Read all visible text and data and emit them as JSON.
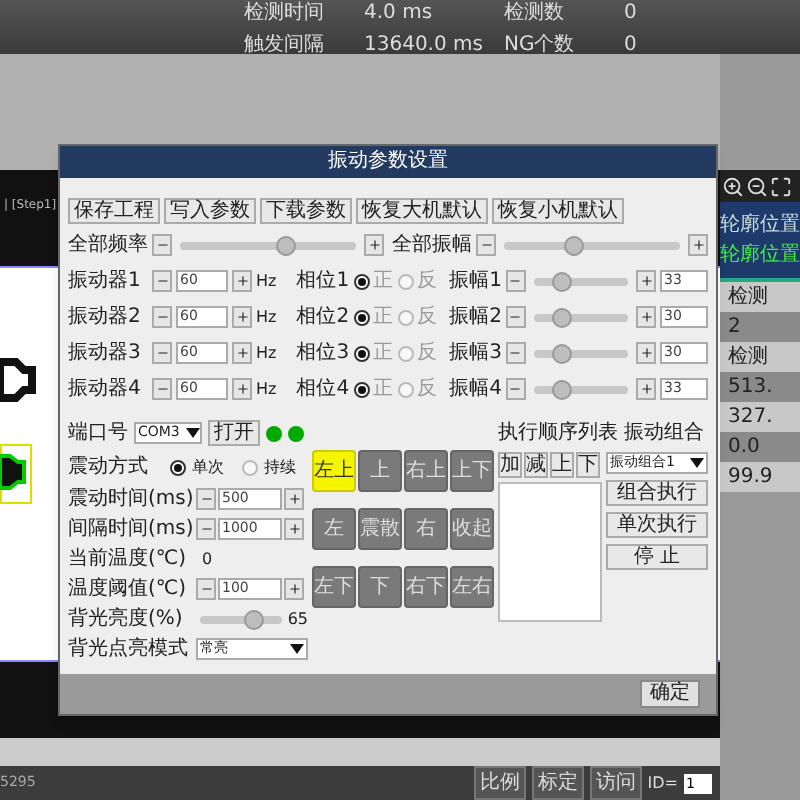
{
  "top_stats": [
    {
      "label": "检测时间",
      "value": "4.0 ms"
    },
    {
      "label": "检测数",
      "value": "0"
    },
    {
      "label": "触发间隔",
      "value": "13640.0 ms"
    },
    {
      "label": "NG个数",
      "value": "0"
    }
  ],
  "view": {
    "step_label": "| [Step1]",
    "status": "5295"
  },
  "side_panel": {
    "heading": "轮廓位置",
    "subheading": "轮廓位置",
    "rows": [
      "检测",
      "2",
      "检测",
      "513.",
      "327.",
      "0.0",
      "99.9"
    ]
  },
  "bottom_bar": {
    "buttons": [
      "比例",
      "标定",
      "访问"
    ],
    "id_label": "ID=",
    "id_value": "1"
  },
  "dialog": {
    "title": "振动参数设置",
    "toolbar": [
      "保存工程",
      "写入参数",
      "下载参数",
      "恢复大机默认",
      "恢复小机默认"
    ],
    "all_freq": {
      "label": "全部频率",
      "level": 0.6
    },
    "all_amp": {
      "label": "全部振幅",
      "level": 0.4
    },
    "vibrators": [
      {
        "name": "振动器1",
        "freq": "60",
        "unit": "Hz",
        "phase_label": "相位1",
        "phases": [
          {
            "label": "正",
            "selected": true
          },
          {
            "label": "反",
            "selected": false
          }
        ],
        "amp_label": "振幅1",
        "level": 0.3,
        "amp": "33"
      },
      {
        "name": "振动器2",
        "freq": "60",
        "unit": "Hz",
        "phase_label": "相位2",
        "phases": [
          {
            "label": "正",
            "selected": true
          },
          {
            "label": "反",
            "selected": false
          }
        ],
        "amp_label": "振幅2",
        "level": 0.3,
        "amp": "30"
      },
      {
        "name": "振动器3",
        "freq": "60",
        "unit": "Hz",
        "phase_label": "相位3",
        "phases": [
          {
            "label": "正",
            "selected": true
          },
          {
            "label": "反",
            "selected": false
          }
        ],
        "amp_label": "振幅3",
        "level": 0.3,
        "amp": "30"
      },
      {
        "name": "振动器4",
        "freq": "60",
        "unit": "Hz",
        "phase_label": "相位4",
        "phases": [
          {
            "label": "正",
            "selected": true
          },
          {
            "label": "反",
            "selected": false
          }
        ],
        "amp_label": "振幅4",
        "level": 0.3,
        "amp": "33"
      }
    ],
    "port": {
      "label": "端口号",
      "value": "COM3",
      "open": "打开",
      "lights": [
        {
          "on": true
        },
        {
          "on": true
        }
      ]
    },
    "mode": {
      "label": "震动方式",
      "options": [
        {
          "label": "单次",
          "selected": true
        },
        {
          "label": "持续",
          "selected": false
        }
      ]
    },
    "fields": [
      {
        "kind": "spin",
        "label": "震动时间(ms)",
        "value": "500"
      },
      {
        "kind": "spin",
        "label": "间隔时间(ms)",
        "value": "1000"
      },
      {
        "kind": "readout",
        "label": "当前温度(℃)",
        "value": "0"
      },
      {
        "kind": "spin",
        "label": "温度阈值(℃)",
        "value": "100"
      },
      {
        "kind": "slider",
        "label": "背光亮度(%)",
        "level": 0.65,
        "value": "65"
      },
      {
        "kind": "select",
        "label": "背光点亮模式",
        "value": "常亮"
      }
    ],
    "directions": [
      {
        "label": "左上",
        "selected": true
      },
      {
        "label": "上",
        "selected": false
      },
      {
        "label": "右上",
        "selected": false
      },
      {
        "label": "上下",
        "selected": false
      },
      {
        "label": "左",
        "selected": false
      },
      {
        "label": "震散",
        "selected": false
      },
      {
        "label": "右",
        "selected": false
      },
      {
        "label": "收起",
        "selected": false
      },
      {
        "label": "左下",
        "selected": false
      },
      {
        "label": "下",
        "selected": false
      },
      {
        "label": "右下",
        "selected": false
      },
      {
        "label": "左右",
        "selected": false
      }
    ],
    "sequence": {
      "title": "执行顺序列表",
      "buttons": [
        "加",
        "减",
        "上",
        "下"
      ]
    },
    "combo": {
      "title": "振动组合",
      "value": "振动组合1",
      "buttons": [
        "组合执行",
        "单次执行",
        "停 止"
      ]
    },
    "ok": "确定"
  }
}
